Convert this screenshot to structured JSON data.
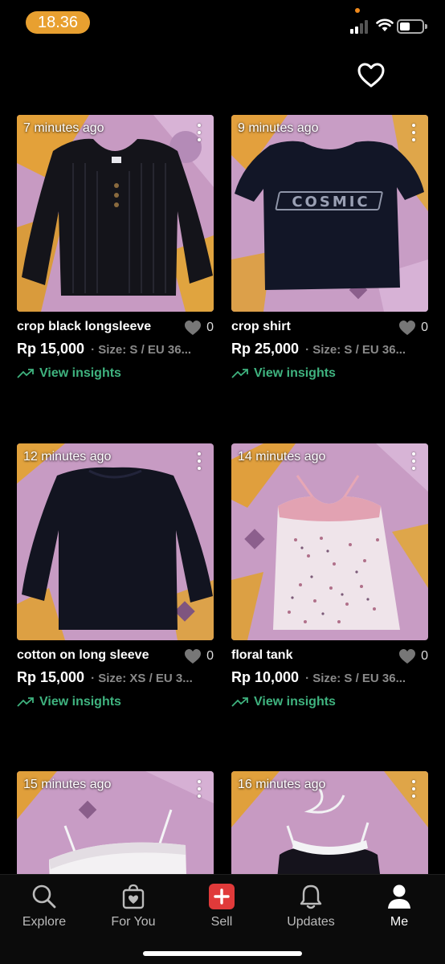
{
  "status_bar": {
    "time": "18.36",
    "time_pill_color": "#e8a030"
  },
  "accent_color": "#3fb37f",
  "sell_color": "#e03a3a",
  "listings": [
    {
      "time_ago": "7 minutes ago",
      "title": "crop black longsleeve",
      "likes": "0",
      "price": "Rp 15,000",
      "size": "· Size: S / EU 36...",
      "insights": "View insights",
      "image": "black ribbed henley longsleeve"
    },
    {
      "time_ago": "9 minutes ago",
      "title": "crop shirt",
      "likes": "0",
      "price": "Rp 25,000",
      "size": "· Size: S / EU 36...",
      "insights": "View insights",
      "image": "black crop tee with COSMIC print",
      "print_text": "COSMIC"
    },
    {
      "time_ago": "12 minutes ago",
      "title": "cotton on long sleeve",
      "likes": "0",
      "price": "Rp 15,000",
      "size": "· Size: XS / EU 3...",
      "insights": "View insights",
      "image": "black long sleeve top"
    },
    {
      "time_ago": "14 minutes ago",
      "title": "floral tank",
      "likes": "0",
      "price": "Rp 10,000",
      "size": "· Size: S / EU 36...",
      "insights": "View insights",
      "image": "floral lace camisole"
    },
    {
      "time_ago": "15 minutes ago",
      "image": "white camisole"
    },
    {
      "time_ago": "16 minutes ago",
      "image": "black halter top with white trim"
    }
  ],
  "nav": [
    {
      "label": "Explore",
      "icon": "search-icon"
    },
    {
      "label": "For You",
      "icon": "shopping-bag-heart-icon"
    },
    {
      "label": "Sell",
      "icon": "plus-icon"
    },
    {
      "label": "Updates",
      "icon": "bell-icon"
    },
    {
      "label": "Me",
      "icon": "person-icon",
      "active": true
    }
  ]
}
